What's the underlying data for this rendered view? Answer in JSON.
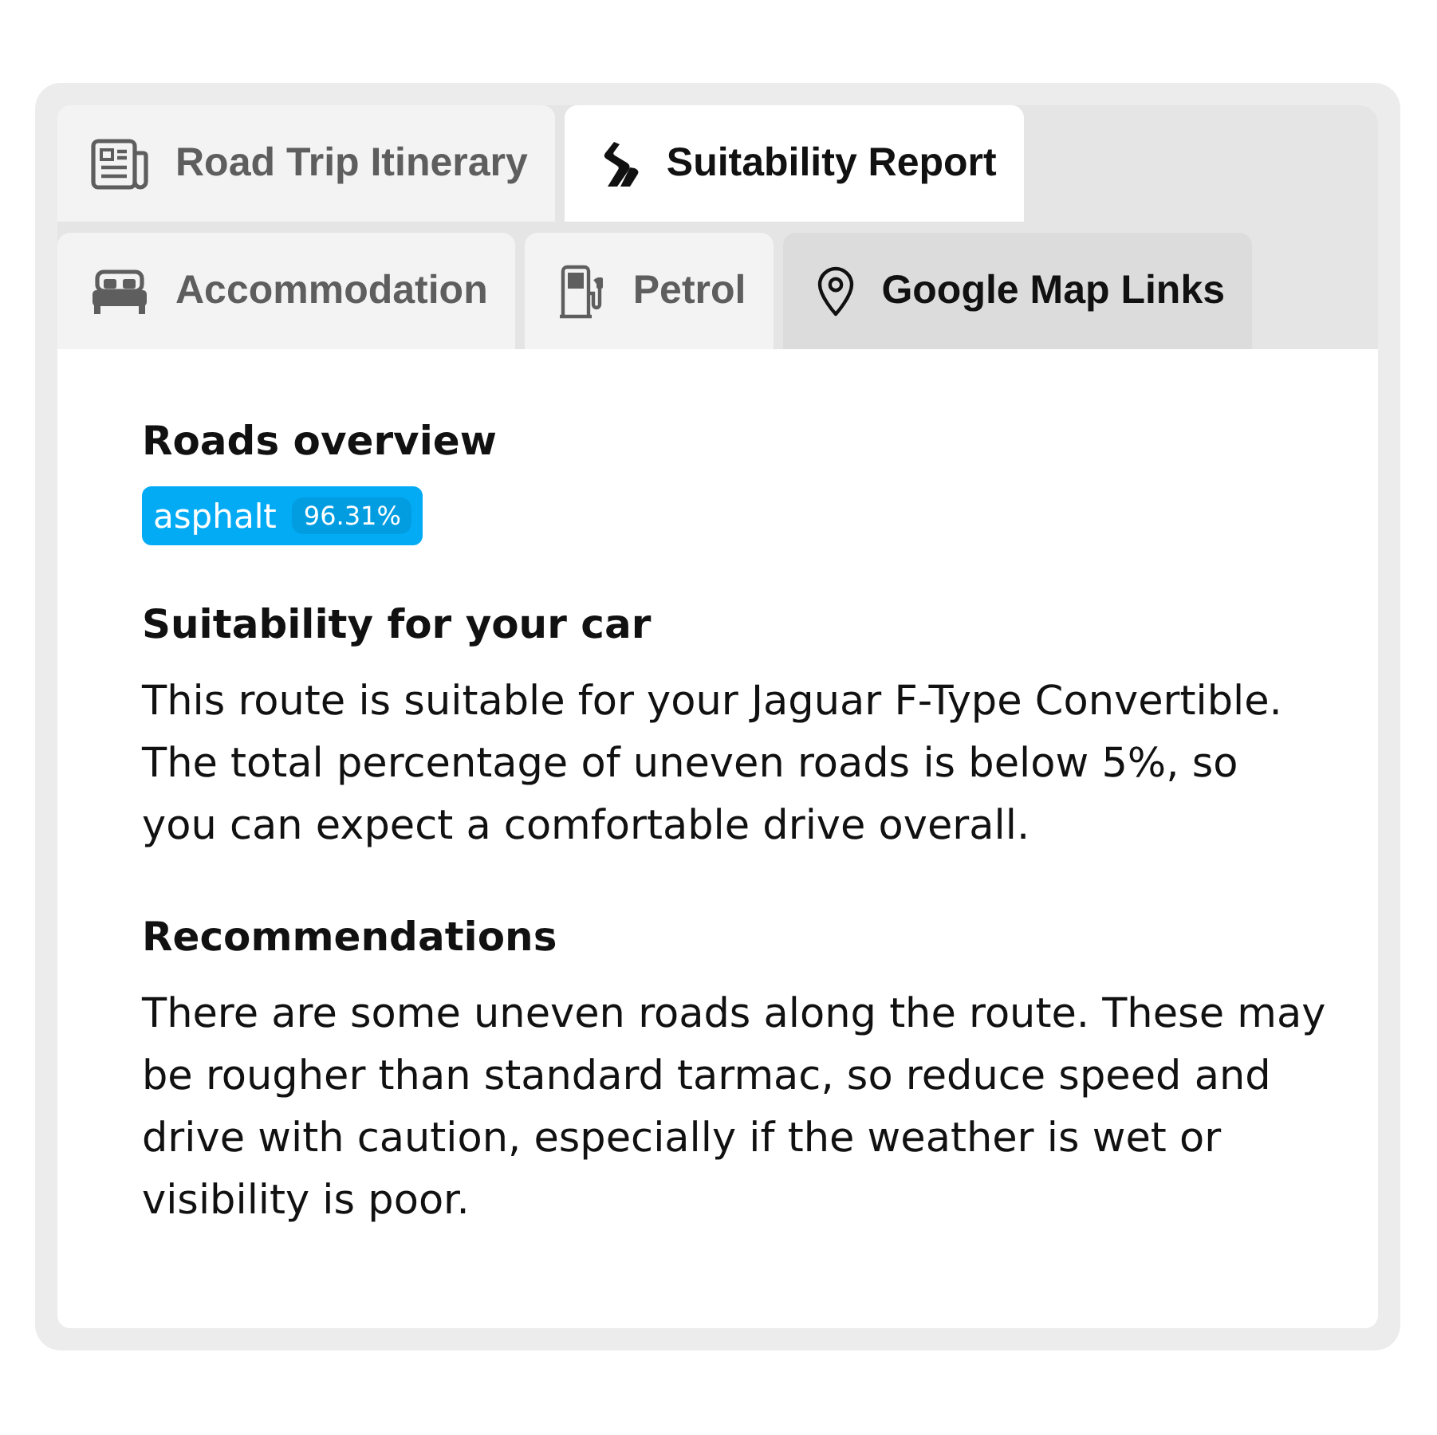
{
  "tabs": [
    {
      "label": "Road Trip Itinerary",
      "kind": "itinerary",
      "selected": false,
      "highlighted": false
    },
    {
      "label": "Suitability Report",
      "kind": "report",
      "selected": true,
      "highlighted": false
    },
    {
      "label": "Accommodation",
      "kind": "lodging",
      "selected": false,
      "highlighted": false
    },
    {
      "label": "Petrol",
      "kind": "fuel",
      "selected": false,
      "highlighted": false
    },
    {
      "label": "Google Map Links",
      "kind": "map",
      "selected": false,
      "highlighted": true
    }
  ],
  "sections": [
    {
      "heading": "Roads overview",
      "badges": [
        {
          "label": "asphalt",
          "value": "96.31%",
          "color": "#03abf5"
        }
      ]
    },
    {
      "heading": "Suitability for your car",
      "text": "This route is suitable for your Jaguar F-Type Convertible.\nThe total percentage of uneven roads is below 5%, so\nyou can expect a comfortable drive overall."
    },
    {
      "heading": "Recommendations",
      "text": "There are some uneven roads along the route. These may\nbe rougher than standard tarmac, so reduce speed and\ndrive with caution, especially if the weather is wet or\nvisibility is poor."
    }
  ]
}
